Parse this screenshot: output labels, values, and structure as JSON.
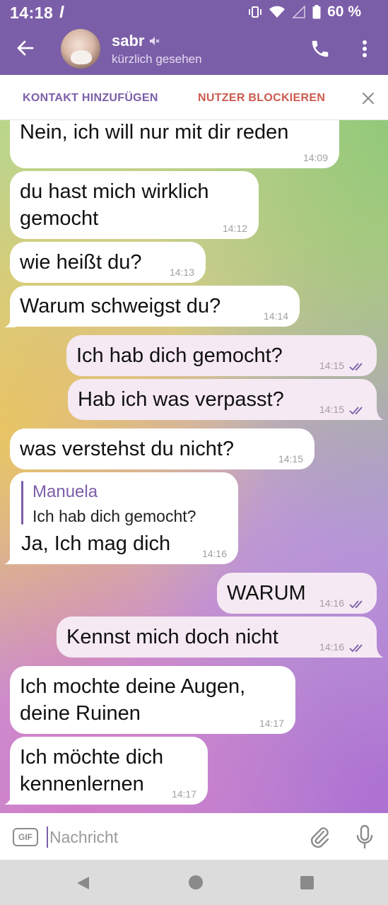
{
  "status_bar": {
    "time": "14:18",
    "indicator": "l",
    "battery_percent": "60 %",
    "icons": [
      "vibrate-icon",
      "wifi-icon",
      "signal-icon",
      "battery-icon"
    ]
  },
  "header": {
    "contact_name": "sabr",
    "status": "kürzlich gesehen",
    "muted": true
  },
  "action_bar": {
    "add_contact": "KONTAKT HINZUFÜGEN",
    "block_user": "NUTZER BLOCKIEREN"
  },
  "colors": {
    "accent": "#7b5ea8",
    "block": "#cc5a4e",
    "outgoing_bubble": "#f5e9f3",
    "incoming_bubble": "#ffffff",
    "read_ticks": "#7b5ea8"
  },
  "messages": [
    {
      "direction": "in",
      "text": "Nein, ich will nur mit dir reden",
      "time": "14:09"
    },
    {
      "direction": "in",
      "lines": [
        "du hast mich wirklich",
        "gemocht"
      ],
      "time": "14:12"
    },
    {
      "direction": "in",
      "text": "wie heißt du?",
      "time": "14:13"
    },
    {
      "direction": "in",
      "text": "Warum schweigst du?",
      "time": "14:14"
    },
    {
      "direction": "out",
      "text": "Ich hab dich gemocht?",
      "time": "14:15",
      "read": true
    },
    {
      "direction": "out",
      "text": "Hab ich was verpasst?",
      "time": "14:15",
      "read": true
    },
    {
      "direction": "in",
      "text": "was verstehst du nicht?",
      "time": "14:15"
    },
    {
      "direction": "in",
      "reply_to": {
        "name": "Manuela",
        "text": "Ich hab dich gemocht?"
      },
      "text": "Ja, Ich mag dich",
      "time": "14:16"
    },
    {
      "direction": "out",
      "text": "WARUM",
      "time": "14:16",
      "read": true
    },
    {
      "direction": "out",
      "text": "Kennst mich doch nicht",
      "time": "14:16",
      "read": true
    },
    {
      "direction": "in",
      "lines": [
        "Ich mochte deine Augen,",
        "deine Ruinen"
      ],
      "time": "14:17"
    },
    {
      "direction": "in",
      "lines": [
        "Ich möchte dich",
        "kennenlernen"
      ],
      "time": "14:17"
    }
  ],
  "input": {
    "gif_label": "GIF",
    "placeholder": "Nachricht",
    "value": ""
  }
}
